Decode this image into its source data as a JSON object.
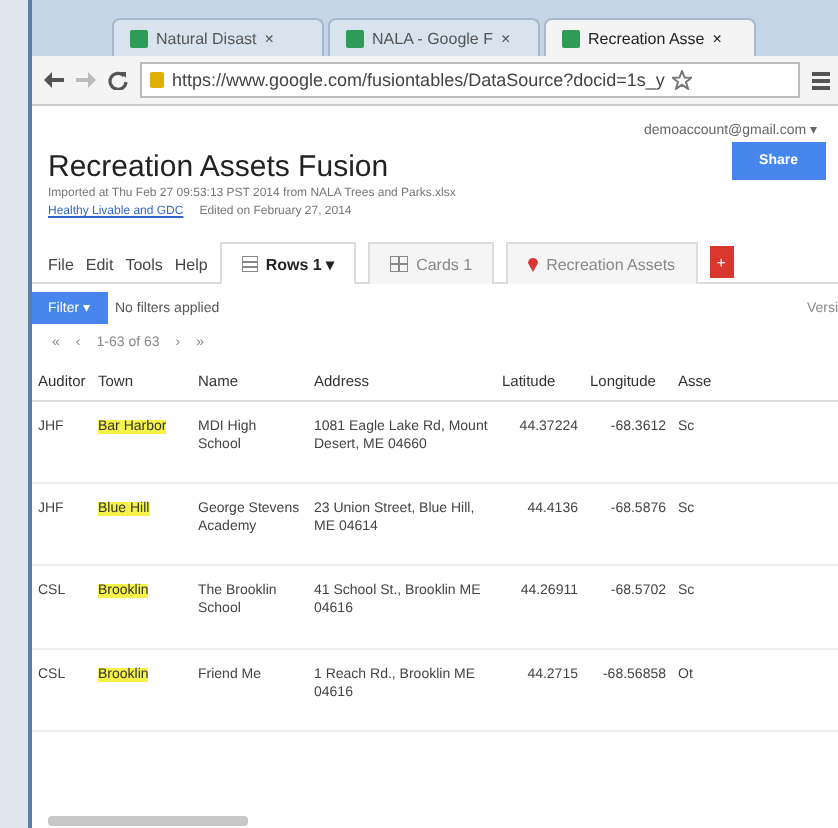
{
  "browser": {
    "tabs": [
      {
        "title": "Natural Disast",
        "selected": false
      },
      {
        "title": "NALA - Google F",
        "selected": false
      },
      {
        "title": "Recreation Asse",
        "selected": true
      }
    ],
    "close_glyph": "×",
    "url": "https://www.google.com/fusiontables/DataSource?docid=1s_y"
  },
  "account": "demoaccount@gmail.com ▾",
  "title": "Recreation Assets Fusion",
  "subtitle": "Imported at Thu Feb 27 09:53:13 PST 2014 from NALA Trees and Parks.xlsx",
  "source_link": "Healthy Livable and GDC",
  "edited": "Edited on February 27, 2014",
  "share_button": "Share",
  "menu": [
    "File",
    "Edit",
    "Tools",
    "Help"
  ],
  "view_tabs": [
    {
      "label": "Rows 1 ▾",
      "kind": "rows",
      "selected": true
    },
    {
      "label": "Cards 1",
      "kind": "cards",
      "selected": false
    },
    {
      "label": "Recreation Assets",
      "kind": "map",
      "selected": false
    }
  ],
  "add_tab": "+",
  "filter_button": "Filter ▾",
  "filter_status": "No filters applied",
  "filter_right": "Versi",
  "pager": {
    "first": "«",
    "prev": "‹",
    "range": "1-63 of 63",
    "next": "›",
    "last": "»"
  },
  "table": {
    "columns": [
      "Auditor",
      "Town",
      "Name",
      "Address",
      "Latitude",
      "Longitude",
      "Asse"
    ],
    "rows": [
      {
        "cells": [
          "JHF",
          "Bar Harbor",
          "MDI High School",
          "1081 Eagle Lake Rd, Mount Desert, ME 04660",
          "44.37224",
          "-68.3612",
          "Sc"
        ]
      },
      {
        "cells": [
          "JHF",
          "Blue Hill",
          "George Stevens Academy",
          "23 Union Street, Blue Hill, ME 04614",
          "44.4136",
          "-68.5876",
          "Sc"
        ]
      },
      {
        "cells": [
          "CSL",
          "Brooklin",
          "The Brooklin School",
          "41 School St., Brooklin ME 04616",
          "44.26911",
          "-68.5702",
          "Sc"
        ]
      },
      {
        "cells": [
          "CSL",
          "Brooklin",
          "Friend Me",
          "1 Reach Rd., Brooklin ME 04616",
          "44.2715",
          "-68.56858",
          "Ot"
        ]
      }
    ]
  }
}
